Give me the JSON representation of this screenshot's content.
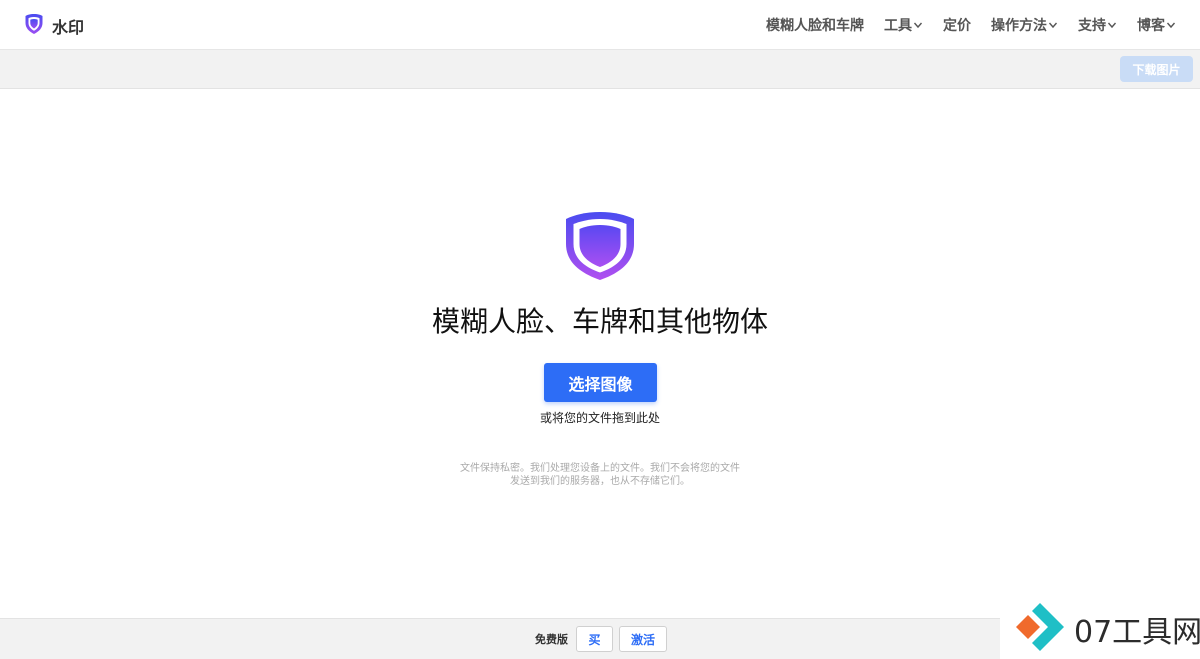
{
  "header": {
    "brand_name": "水印",
    "nav": [
      {
        "label": "模糊人脸和车牌",
        "dropdown": false
      },
      {
        "label": "工具",
        "dropdown": true
      },
      {
        "label": "定价",
        "dropdown": false
      },
      {
        "label": "操作方法",
        "dropdown": true
      },
      {
        "label": "支持",
        "dropdown": true
      },
      {
        "label": "博客",
        "dropdown": true
      }
    ]
  },
  "toolbar": {
    "download_label": "下载图片"
  },
  "main": {
    "headline": "模糊人脸、车牌和其他物体",
    "select_label": "选择图像",
    "drop_hint": "或将您的文件拖到此处",
    "privacy_line1": "文件保持私密。我们处理您设备上的文件。我们不会将您的文件",
    "privacy_line2": "发送到我们的服务器，也从不存储它们。"
  },
  "footer": {
    "plan_label": "免费版",
    "buy_label": "买",
    "activate_label": "激活"
  },
  "watermark": {
    "text": "07工具网"
  },
  "colors": {
    "accent": "#2d6df6",
    "shield_top": "#6a3cf5",
    "shield_bottom": "#a54df2",
    "download_disabled": "#c9dcf6"
  }
}
